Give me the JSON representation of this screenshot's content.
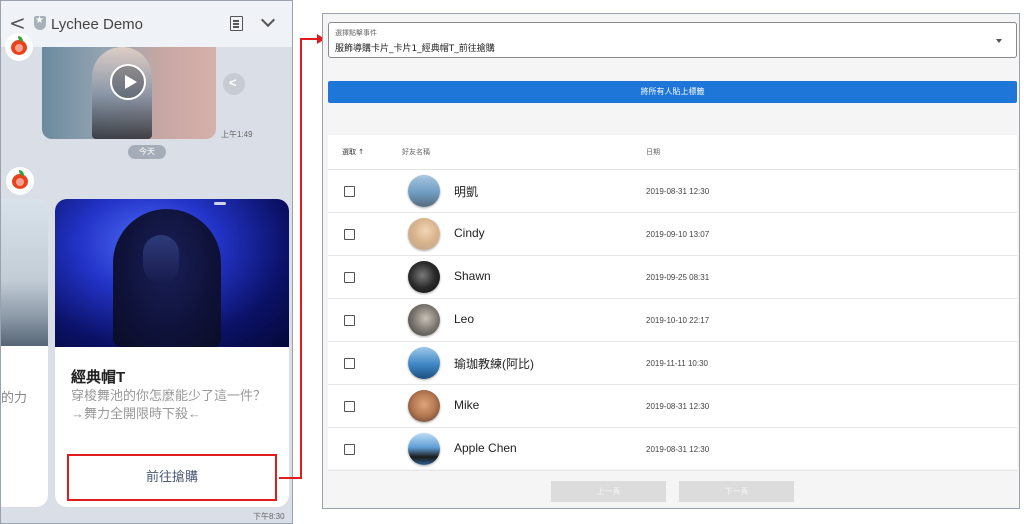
{
  "phone": {
    "chat_title": "Lychee Demo",
    "video_time": "上午1:49",
    "date_pill": "今天",
    "left_card_text": "的力",
    "card": {
      "title": "經典帽T",
      "description": "穿梭舞池的你怎麼能少了這一件？→舞力全開限時下殺←",
      "button_label": "前往搶購"
    },
    "card_time": "下午8:30"
  },
  "admin": {
    "select_label": "選擇點擊事件",
    "select_value": "服飾導購卡片_卡片1_經典帽T_前往搶購",
    "tag_all_button": "將所有人貼上標籤",
    "table": {
      "headers": {
        "select": "選取 ↑",
        "name": "好友名稱",
        "date": "日期"
      },
      "rows": [
        {
          "name": "明凱",
          "date": "2019-08-31 12:30",
          "avatar_color": "#7fa8c9"
        },
        {
          "name": "Cindy",
          "date": "2019-09-10 13:07",
          "avatar_color": "#e0c29b"
        },
        {
          "name": "Shawn",
          "date": "2019-09-25 08:31",
          "avatar_color": "#2a2a2a"
        },
        {
          "name": "Leo",
          "date": "2019-10-10 22:17",
          "avatar_color": "#6b6b6b"
        },
        {
          "name": "瑜珈教練(阿比)",
          "date": "2019-11-11 10:30",
          "avatar_color": "#3b7fb8"
        },
        {
          "name": "Mike",
          "date": "2019-08-31 12:30",
          "avatar_color": "#c98a63"
        },
        {
          "name": "Apple Chen",
          "date": "2019-08-31 12:30",
          "avatar_color": "#4f8fc7"
        }
      ]
    },
    "pager": {
      "prev": "上一頁",
      "next": "下一頁"
    }
  },
  "colors": {
    "highlight_red": "#e21c1c",
    "primary_blue": "#1e76d8"
  }
}
